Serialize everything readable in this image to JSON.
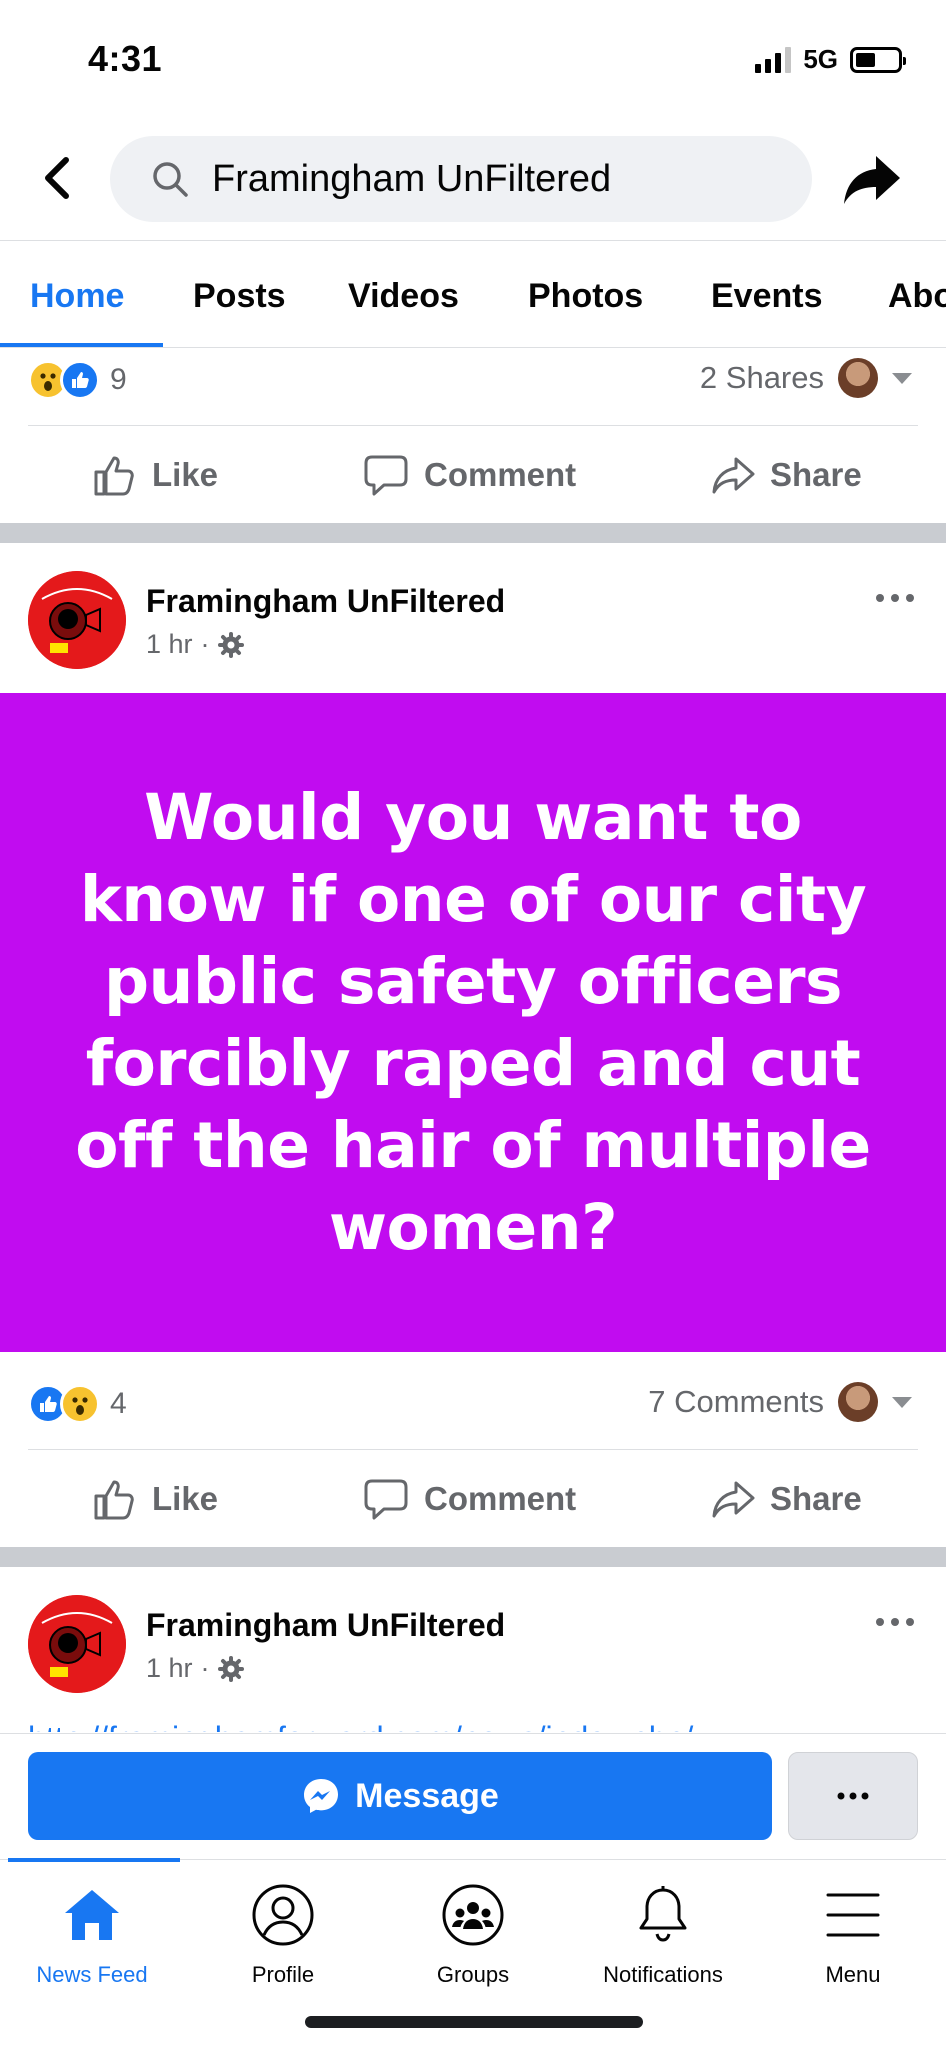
{
  "status_bar": {
    "time": "4:31",
    "network": "5G"
  },
  "header": {
    "search_text": "Framingham UnFiltered"
  },
  "tabs": [
    "Home",
    "Posts",
    "Videos",
    "Photos",
    "Events",
    "Abo"
  ],
  "prev_post": {
    "reaction_count": "9",
    "shares": "2 Shares",
    "actions": {
      "like": "Like",
      "comment": "Comment",
      "share": "Share"
    }
  },
  "post1": {
    "page_name": "Framingham UnFiltered",
    "time": "1 hr",
    "graphic_text": "Would you want to know if one of our city public safety officers forcibly raped and cut off the hair of multiple women?",
    "graphic_bg": "#c10cf0",
    "reaction_count": "4",
    "comments": "7 Comments",
    "actions": {
      "like": "Like",
      "comment": "Comment",
      "share": "Share"
    }
  },
  "post2": {
    "page_name": "Framingham UnFiltered",
    "time": "1 hr",
    "link_peek": "http://framinghamforward.com/news/index.php/"
  },
  "message_bar": {
    "label": "Message"
  },
  "bottom_nav": [
    "News Feed",
    "Profile",
    "Groups",
    "Notifications",
    "Menu"
  ],
  "colors": {
    "accent": "#1877f2",
    "wow": "#f7c22f",
    "separator": "#c9ccd1"
  }
}
